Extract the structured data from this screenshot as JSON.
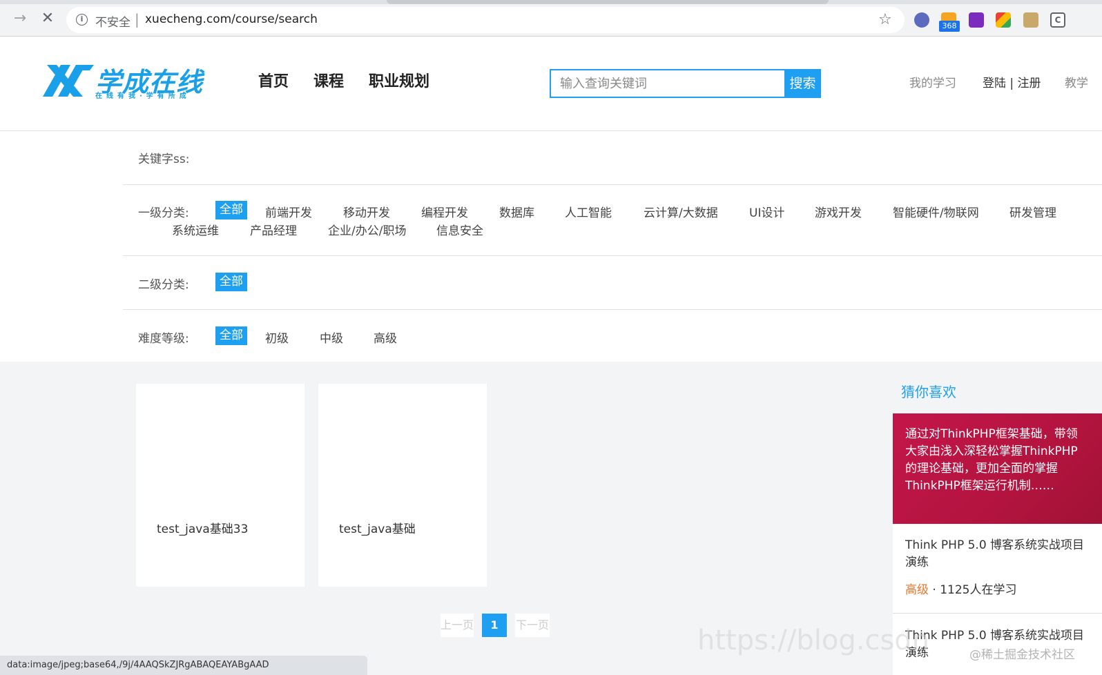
{
  "browser": {
    "insecure_label": "不安全",
    "separator": "|",
    "url": "xuecheng.com/course/search",
    "ext_badge": "368"
  },
  "site": {
    "logo_text": "学成在线",
    "logo_sub": "在线有我·学有所成",
    "nav": [
      "首页",
      "课程",
      "职业规划"
    ],
    "search_placeholder": "输入查询关键词",
    "search_button": "搜索",
    "my_learning": "我的学习",
    "login_register": "登陆 | 注册",
    "teach": "教学"
  },
  "filters": {
    "keyword_label": "关键字ss:",
    "level1_label": "一级分类:",
    "level1_options": [
      "全部",
      "前端开发",
      "移动开发",
      "编程开发",
      "数据库",
      "人工智能",
      "云计算/大数据",
      "UI设计",
      "游戏开发",
      "智能硬件/物联网",
      "研发管理",
      "系统运维",
      "产品经理",
      "企业/办公/职场",
      "信息安全"
    ],
    "level2_label": "二级分类:",
    "level2_options": [
      "全部"
    ],
    "difficulty_label": "难度等级:",
    "difficulty_options": [
      "全部",
      "初级",
      "中级",
      "高级"
    ]
  },
  "courses": [
    {
      "title": "test_java基础33"
    },
    {
      "title": "test_java基础"
    }
  ],
  "pagination": {
    "prev": "上一页",
    "current": "1",
    "next": "下一页"
  },
  "sidebar": {
    "title": "猜你喜欢",
    "promo_text": "通过对ThinkPHP框架基础，带领大家由浅入深轻松掌握ThinkPHP的理论基础，更加全面的掌握ThinkPHP框架运行机制……",
    "course_title": "Think PHP 5.0 博客系统实战项目演练",
    "course_level": "高级",
    "course_students": " · 1125人在学习",
    "course2_title": "Think PHP 5.0 博客系统实战项目演练"
  },
  "status_bar": "data:image/jpeg;base64,/9j/4AAQSkZJRgABAQEAYABgAAD",
  "watermark": "https://blog.csdn",
  "watermark2": "@稀土掘金技术社区",
  "colors": {
    "accent": "#1e9ff2",
    "promo": "#c3164a",
    "level": "#e8762c"
  }
}
